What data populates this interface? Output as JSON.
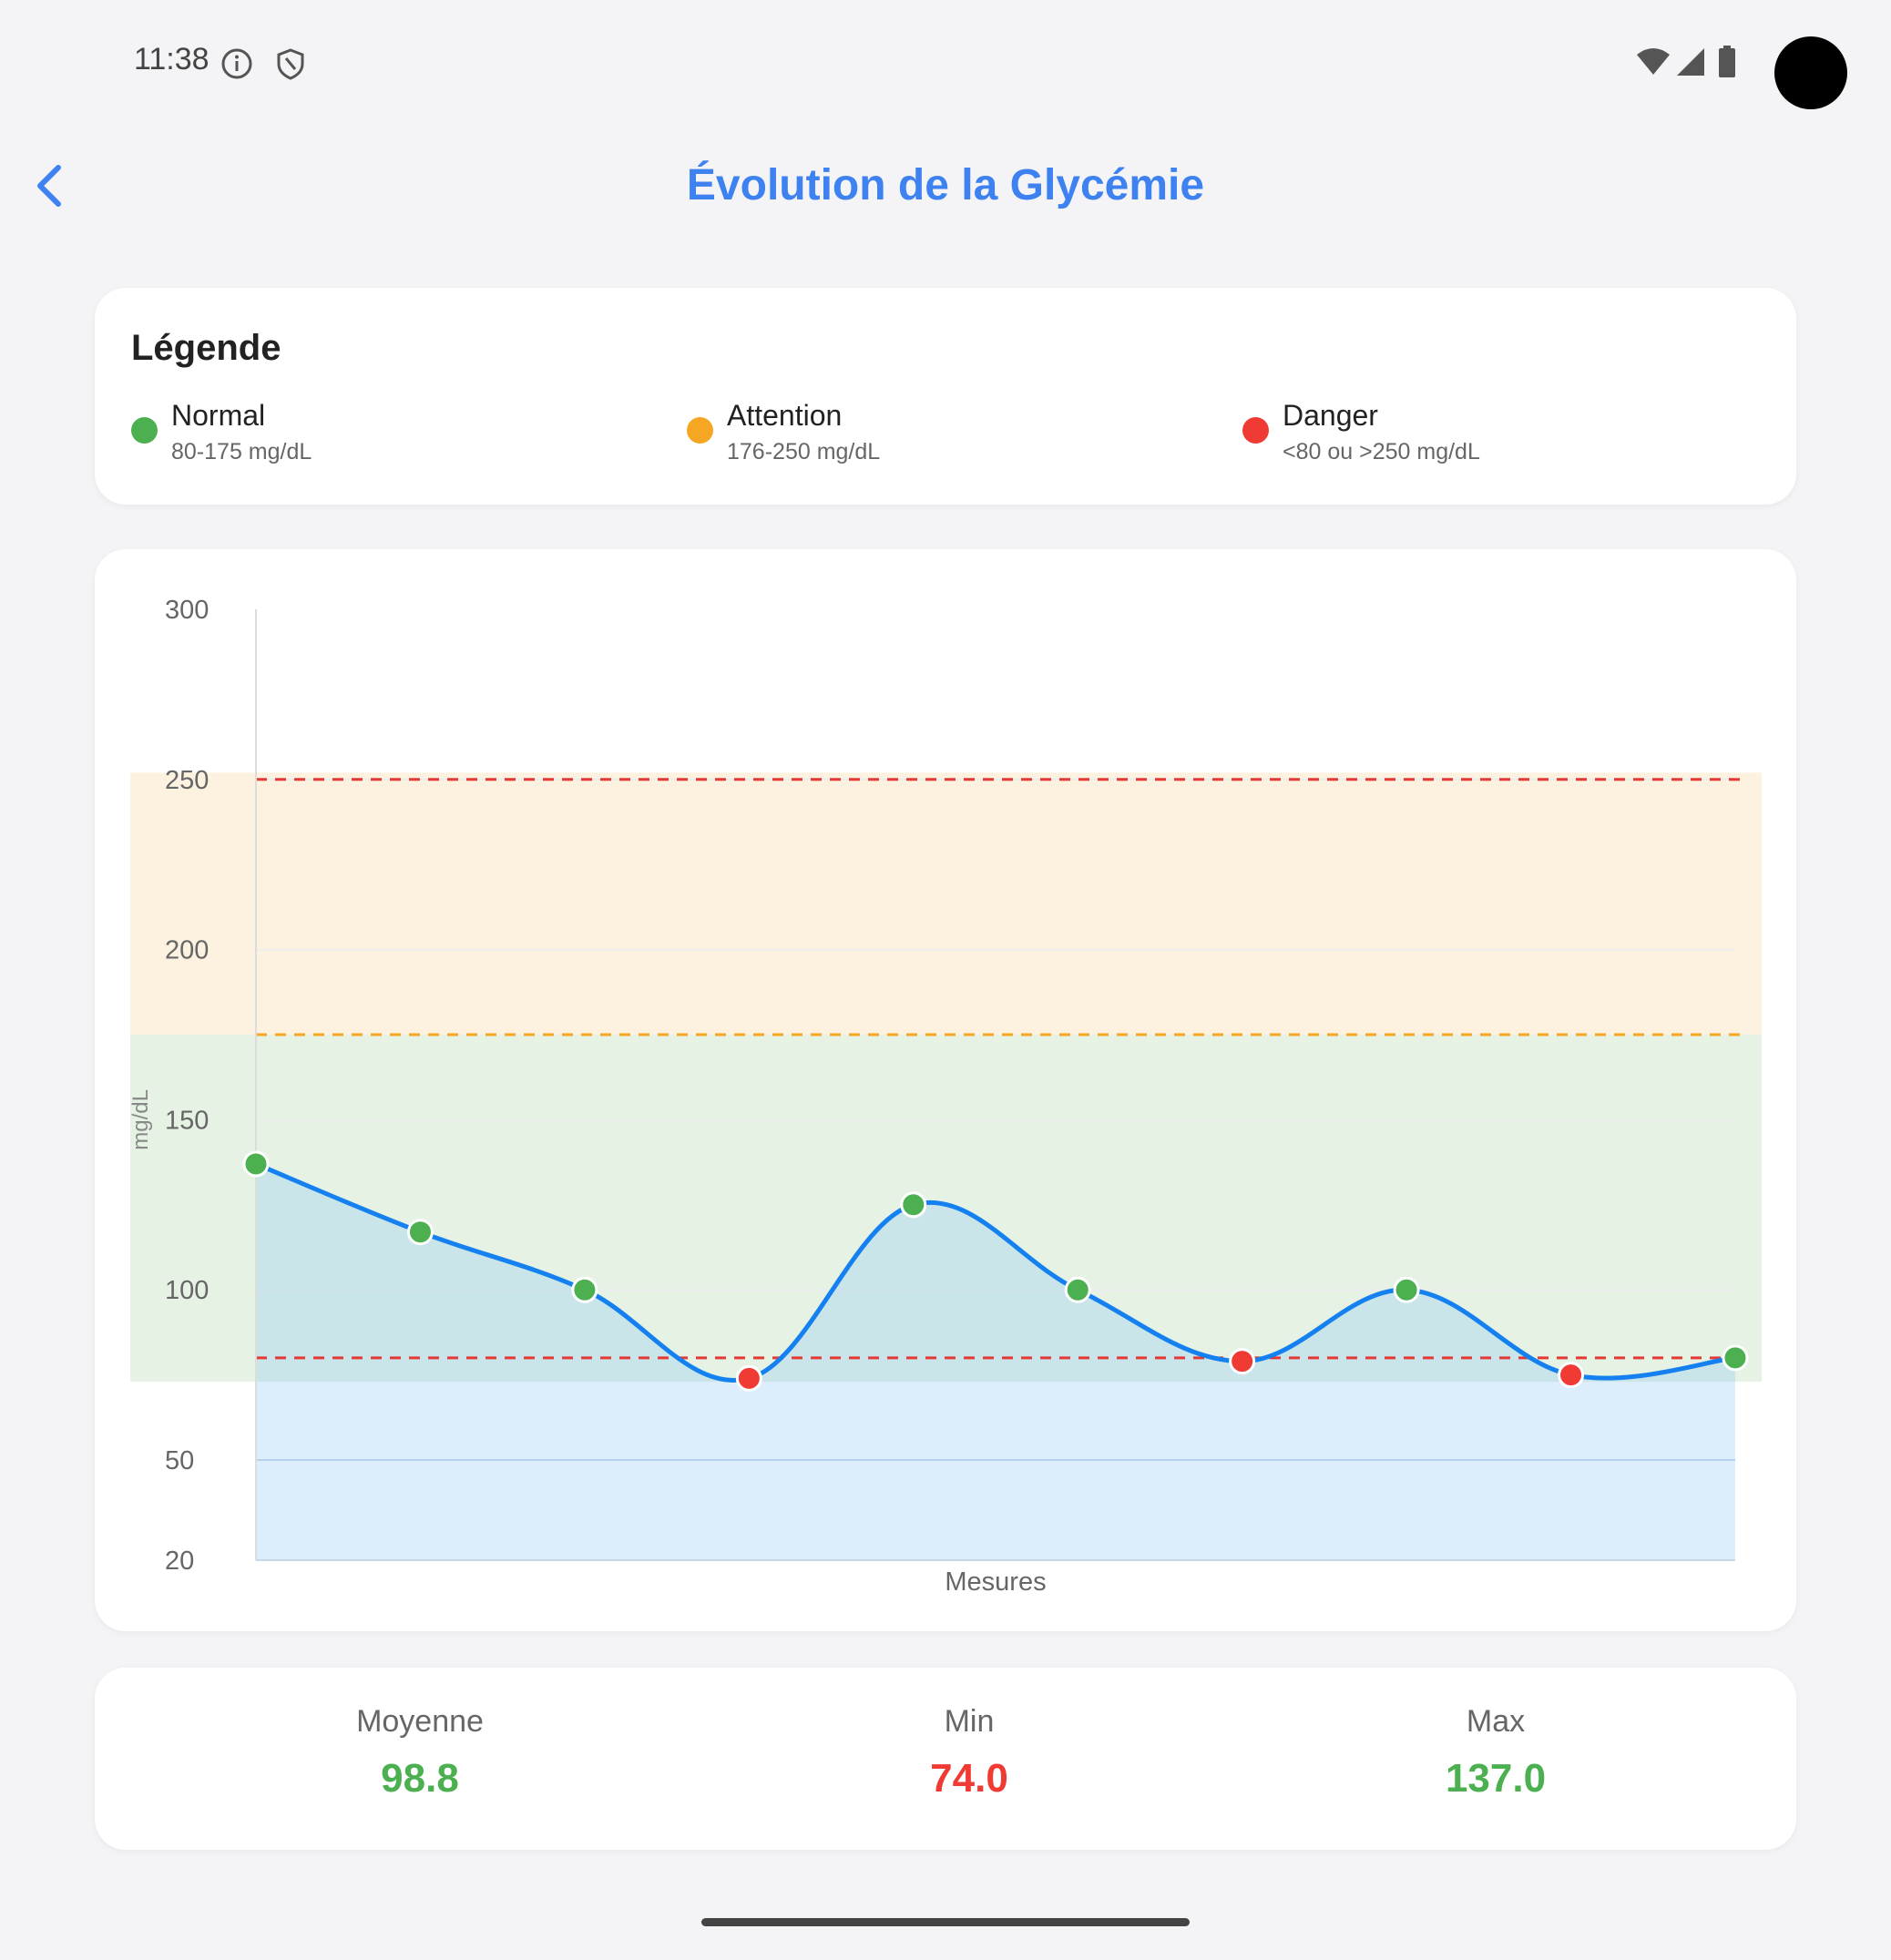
{
  "status_bar": {
    "time": "11:38"
  },
  "header": {
    "title": "Évolution de la Glycémie"
  },
  "legend": {
    "title": "Légende",
    "items": [
      {
        "label": "Normal",
        "range": "80-175 mg/dL",
        "color": "#4caf50"
      },
      {
        "label": "Attention",
        "range": "176-250 mg/dL",
        "color": "#f5a623"
      },
      {
        "label": "Danger",
        "range": "<80 ou >250 mg/dL",
        "color": "#ef3b33"
      }
    ]
  },
  "chart_data": {
    "type": "line",
    "xlabel": "Mesures",
    "ylabel": "mg/dL",
    "ylim": [
      20,
      300
    ],
    "y_ticks": [
      "300",
      "250",
      "200",
      "150",
      "100",
      "50",
      "20"
    ],
    "series": [
      {
        "values": [
          137,
          117,
          100,
          74,
          125,
          100,
          79,
          100,
          75,
          80
        ]
      }
    ],
    "zones": [
      {
        "name": "attention",
        "from": 175,
        "to": 252,
        "color": "#fdf1e0"
      },
      {
        "name": "normal",
        "from": 73,
        "to": 175,
        "color": "#e5f2e4"
      }
    ],
    "thresholds": [
      {
        "value": 250,
        "color": "#e53935"
      },
      {
        "value": 175,
        "color": "#f5a623"
      },
      {
        "value": 80,
        "color": "#e53935"
      }
    ],
    "grid": true,
    "line_color": "#1580f0"
  },
  "stats": [
    {
      "label": "Moyenne",
      "value": "98.8",
      "color": "#4caf50"
    },
    {
      "label": "Min",
      "value": "74.0",
      "color": "#ef3b33"
    },
    {
      "label": "Max",
      "value": "137.0",
      "color": "#4caf50"
    }
  ]
}
